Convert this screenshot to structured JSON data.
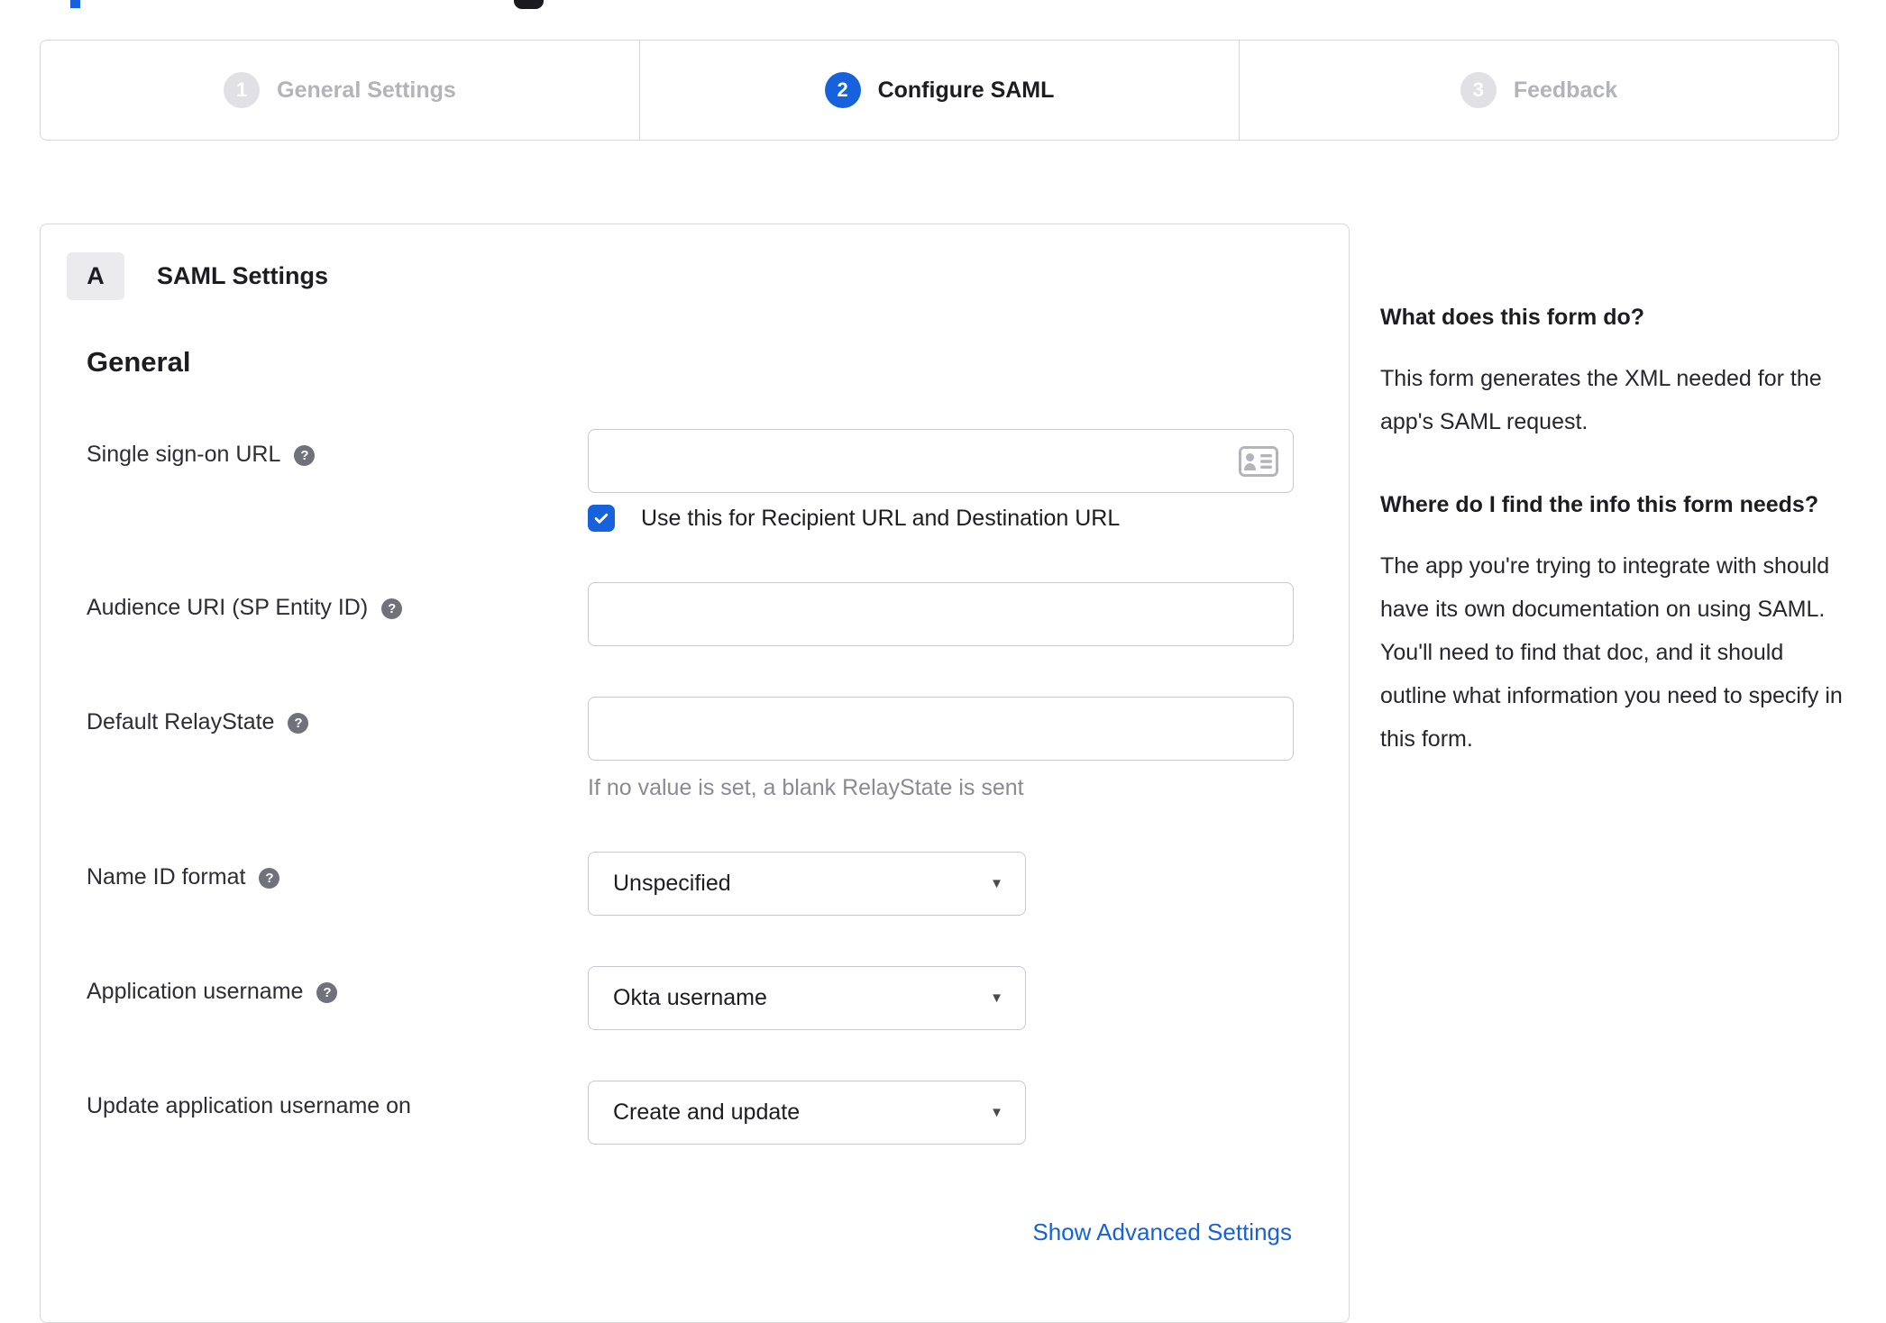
{
  "colors": {
    "accent_blue": "#1662dd",
    "text_dark": "#1d1d21",
    "hint_gray": "#8a8a93",
    "inactive_gray": "#b3b3ba",
    "border_gray": "#d7d7dc"
  },
  "stepper": {
    "steps": [
      {
        "number": "1",
        "label": "General Settings"
      },
      {
        "number": "2",
        "label": "Configure SAML"
      },
      {
        "number": "3",
        "label": "Feedback"
      }
    ],
    "active_step": "Configure SAML"
  },
  "saml_panel": {
    "section_badge": "A",
    "section_title": "SAML Settings",
    "group_heading": "General",
    "sso": {
      "label": "Single sign-on URL",
      "value": "",
      "checkbox_label": "Use this for Recipient URL and Destination URL",
      "checkbox_checked": true
    },
    "audience": {
      "label": "Audience URI (SP Entity ID)",
      "value": ""
    },
    "relay_state": {
      "label": "Default RelayState",
      "value": "",
      "hint": "If no value is set, a blank RelayState is sent"
    },
    "name_id_format": {
      "label": "Name ID format",
      "selected": "Unspecified"
    },
    "application_username": {
      "label": "Application username",
      "selected": "Okta username"
    },
    "update_application_username": {
      "label": "Update application username on",
      "selected": "Create and update"
    },
    "advanced_link": "Show Advanced Settings"
  },
  "help_sidebar": {
    "q1": "What does this form do?",
    "a1": "This form generates the XML needed for the app's SAML request.",
    "q2": "Where do I find the info this form needs?",
    "a2": "The app you're trying to integrate with should have its own documentation on using SAML. You'll need to find that doc, and it should outline what information you need to specify in this form."
  }
}
